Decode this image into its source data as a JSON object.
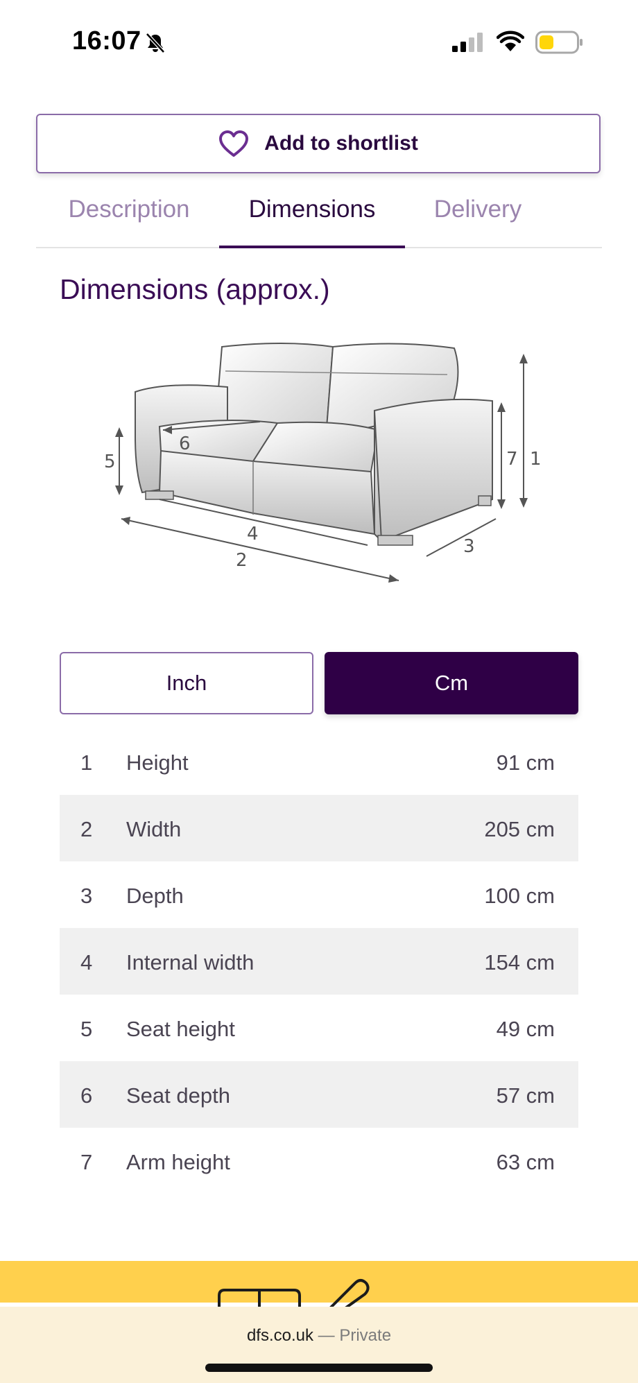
{
  "status": {
    "time": "16:07",
    "icons": [
      "bell-slash-icon",
      "cellular-signal-icon",
      "wifi-icon",
      "battery-icon"
    ]
  },
  "shortlist": {
    "label": "Add to shortlist",
    "icon": "heart-icon"
  },
  "tabs": [
    {
      "label": "Description"
    },
    {
      "label": "Dimensions"
    },
    {
      "label": "Delivery"
    }
  ],
  "active_tab": "Dimensions",
  "section": {
    "title": "Dimensions (approx.)"
  },
  "diagram": {
    "markers": [
      "1",
      "2",
      "3",
      "4",
      "5",
      "6",
      "7"
    ]
  },
  "units": {
    "inch": "Inch",
    "cm": "Cm",
    "selected": "Cm"
  },
  "dimensions": [
    {
      "num": "1",
      "label": "Height",
      "value": "91 cm"
    },
    {
      "num": "2",
      "label": "Width",
      "value": "205 cm"
    },
    {
      "num": "3",
      "label": "Depth",
      "value": "100 cm"
    },
    {
      "num": "4",
      "label": "Internal width",
      "value": "154 cm"
    },
    {
      "num": "5",
      "label": "Seat height",
      "value": "49 cm"
    },
    {
      "num": "6",
      "label": "Seat depth",
      "value": "57 cm"
    },
    {
      "num": "7",
      "label": "Arm height",
      "value": "63 cm"
    }
  ],
  "browser": {
    "url": "dfs.co.uk",
    "separator": "—",
    "mode": "Private"
  },
  "colors": {
    "brand_purple": "#2f0046",
    "accent_purple": "#3a0c55",
    "muted_purple": "#9b84ae",
    "yellow": "#ffd04d",
    "battery_yellow": "#ffd60a"
  }
}
